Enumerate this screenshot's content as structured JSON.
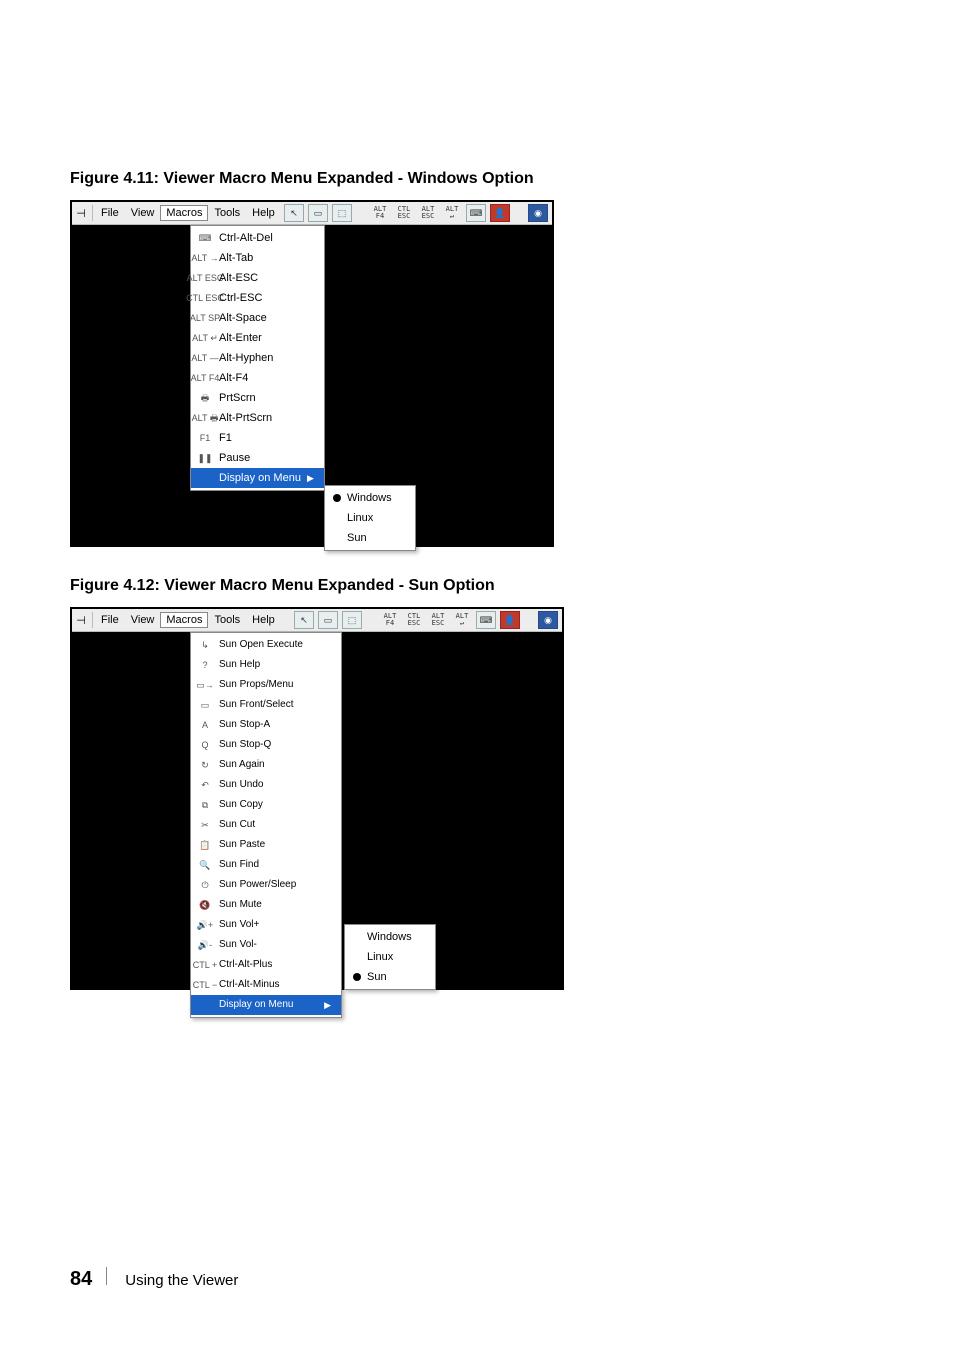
{
  "captions": {
    "fig411": "Figure 4.11: Viewer Macro Menu Expanded - Windows Option",
    "fig412": "Figure 4.12: Viewer Macro Menu Expanded - Sun Option"
  },
  "menubar": {
    "file": "File",
    "view": "View",
    "macros": "Macros",
    "tools": "Tools",
    "help": "Help"
  },
  "toolbar_icons": {
    "altf4": "ALT\nF4",
    "ctlesc": "CTL\nESC",
    "altesc": "ALT\nESC",
    "altenter": "ALT\n↵"
  },
  "macros_windows": {
    "items": [
      "Ctrl-Alt-Del",
      "Alt-Tab",
      "Alt-ESC",
      "Ctrl-ESC",
      "Alt-Space",
      "Alt-Enter",
      "Alt-Hyphen",
      "Alt-F4",
      "PrtScrn",
      "Alt-PrtScrn",
      "F1",
      "Pause"
    ],
    "display_on_menu": "Display on Menu",
    "submenu": {
      "windows": "Windows",
      "linux": "Linux",
      "sun": "Sun",
      "selected": "windows"
    },
    "icons": [
      "⌨",
      "ALT\n→",
      "ALT\nESC",
      "CTL\nESC",
      "ALT\nSP",
      "ALT\n↵",
      "ALT\n—",
      "ALT\nF4",
      "🖶",
      "ALT\n🖶",
      "F1",
      "❚❚"
    ]
  },
  "macros_sun": {
    "items": [
      "Sun Open Execute",
      "Sun Help",
      "Sun Props/Menu",
      "Sun Front/Select",
      "Sun Stop-A",
      "Sun Stop-Q",
      "Sun Again",
      "Sun Undo",
      "Sun Copy",
      "Sun Cut",
      "Sun Paste",
      "Sun Find",
      "Sun Power/Sleep",
      "Sun Mute",
      "Sun Vol+",
      "Sun Vol-",
      "Ctrl-Alt-Plus",
      "Ctrl-Alt-Minus"
    ],
    "display_on_menu": "Display on Menu",
    "submenu": {
      "windows": "Windows",
      "linux": "Linux",
      "sun": "Sun",
      "selected": "sun"
    },
    "icons": [
      "↳",
      "?",
      "▭→",
      "▭",
      "A",
      "Q",
      "↻",
      "↶",
      "⧉",
      "✂",
      "📋",
      "🔍",
      "⏻",
      "🔇",
      "🔊+",
      "🔊-",
      "CTL\n+",
      "CTL\n−"
    ]
  },
  "footer": {
    "page": "84",
    "section": "Using the Viewer"
  }
}
